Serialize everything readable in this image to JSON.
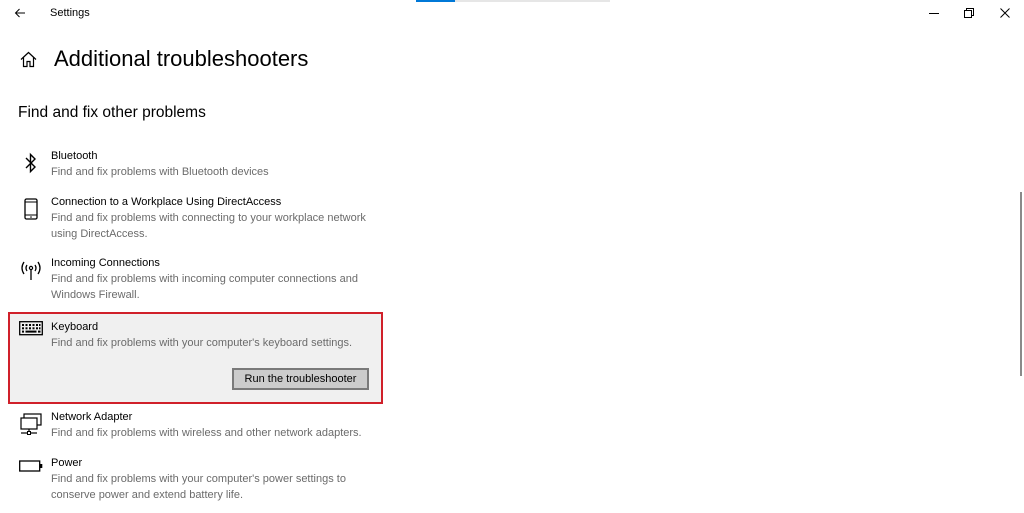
{
  "window": {
    "app_title": "Settings",
    "loading_progress": 0.2
  },
  "page": {
    "title": "Additional troubleshooters",
    "section_title": "Find and fix other problems"
  },
  "troubleshooters": [
    {
      "name": "Bluetooth",
      "description": "Find and fix problems with Bluetooth devices",
      "icon": "bluetooth-icon"
    },
    {
      "name": "Connection to a Workplace Using DirectAccess",
      "description": "Find and fix problems with connecting to your workplace network using DirectAccess.",
      "icon": "phone-device-icon"
    },
    {
      "name": "Incoming Connections",
      "description": "Find and fix problems with incoming computer connections and Windows Firewall.",
      "icon": "antenna-icon"
    },
    {
      "name": "Keyboard",
      "description": "Find and fix problems with your computer's keyboard settings.",
      "icon": "keyboard-icon",
      "selected": true,
      "action_label": "Run the troubleshooter"
    },
    {
      "name": "Network Adapter",
      "description": "Find and fix problems with wireless and other network adapters.",
      "icon": "network-adapter-icon"
    },
    {
      "name": "Power",
      "description": "Find and fix problems with your computer's power settings to conserve power and extend battery life.",
      "icon": "battery-icon"
    }
  ],
  "colors": {
    "highlight_border": "#d0202a",
    "selected_background": "#f0f0f0",
    "description_text": "#6b6b6b",
    "accent": "#0078d7"
  }
}
